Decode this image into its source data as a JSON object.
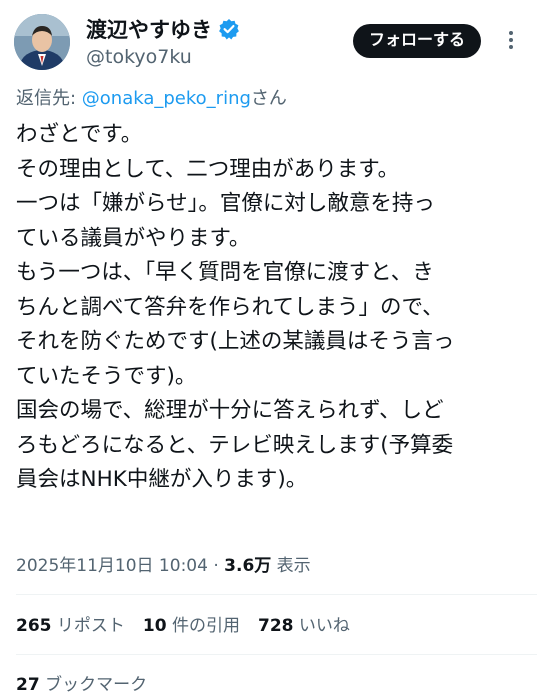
{
  "author": {
    "display_name": "渡辺やすゆき",
    "handle": "@tokyo7ku",
    "verified": true,
    "accent_color": "#1d9bf0"
  },
  "follow_button": {
    "label": "フォローする"
  },
  "reply_to": {
    "prefix": "返信先: ",
    "mention": "@onaka_peko_ring",
    "suffix": "さん"
  },
  "tweet": {
    "lines": [
      "わざとです。",
      "その理由として、二つ理由があります。",
      "一つは「嫌がらせ」。官僚に対し敵意を持っ",
      "ている議員がやります。",
      "もう一つは、「早く質問を官僚に渡すと、き",
      "ちんと調べて答弁を作られてしまう」ので、",
      "それを防ぐためです(上述の某議員はそう言っ",
      "ていたそうです)。",
      "国会の場で、総理が十分に答えられず、しど",
      "ろもどろになると、テレビ映えします(予算委",
      "員会はNHK中継が入ります)。"
    ]
  },
  "meta": {
    "timestamp": "2025年11月10日 10:04",
    "separator": " · ",
    "views_count": "3.6万",
    "views_label": " 表示"
  },
  "stats": {
    "reposts_count": "265",
    "reposts_label": " リポスト",
    "quotes_count": "10",
    "quotes_label": " 件の引用",
    "likes_count": "728",
    "likes_label": " いいね",
    "bookmarks_count": "27",
    "bookmarks_label": " ブックマーク"
  },
  "icons": {
    "verified": "verified-badge-icon",
    "more": "more-options-icon"
  }
}
